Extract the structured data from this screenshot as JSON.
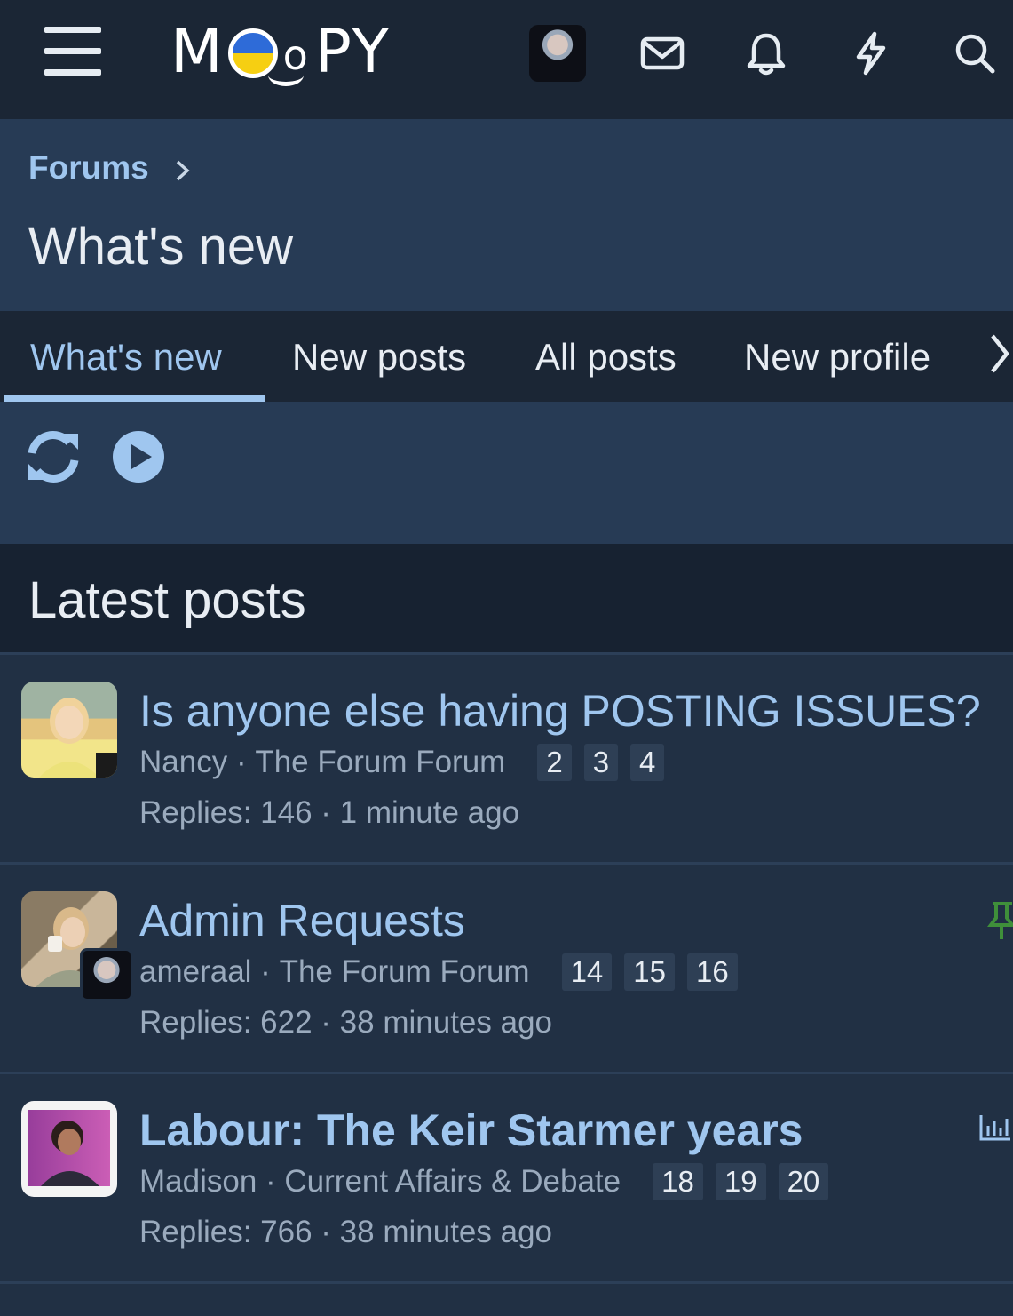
{
  "header": {
    "logo_text": "MOOPY",
    "logo_left": "M",
    "logo_mid": "o",
    "logo_right": "PY",
    "icons": [
      "menu-icon",
      "mail-icon",
      "bell-icon",
      "bolt-icon",
      "search-icon"
    ]
  },
  "breadcrumb": {
    "root": "Forums"
  },
  "page": {
    "title": "What's new"
  },
  "tabs": [
    {
      "label": "What's new",
      "active": true
    },
    {
      "label": "New posts"
    },
    {
      "label": "All posts"
    },
    {
      "label": "New profile"
    }
  ],
  "actions": {
    "icons": [
      "refresh-icon",
      "play-icon"
    ]
  },
  "section": {
    "title": "Latest posts"
  },
  "threads": [
    {
      "title": "Is anyone else having POSTING ISSUES?",
      "author": "Nancy",
      "forum": "The Forum Forum",
      "pages": [
        "2",
        "3",
        "4"
      ],
      "stats": "Replies: 146 · 1 minute ago"
    },
    {
      "title": "Admin Requests",
      "author": "ameraal",
      "forum": "The Forum Forum",
      "pages": [
        "14",
        "15",
        "16"
      ],
      "stats": "Replies: 622 · 38 minutes ago",
      "pinned": true
    },
    {
      "title": "Labour: The Keir Starmer years",
      "author": "Madison",
      "forum": "Current Affairs & Debate",
      "pages": [
        "18",
        "19",
        "20"
      ],
      "stats": "Replies: 766 · 38 minutes ago",
      "poll": true
    }
  ],
  "colors": {
    "accent": "#9fc6ef",
    "header_bg": "#1b2635",
    "panel_bg": "#273b55",
    "row_bg": "#213044",
    "pin": "#3f8f3a"
  },
  "separator": " · "
}
